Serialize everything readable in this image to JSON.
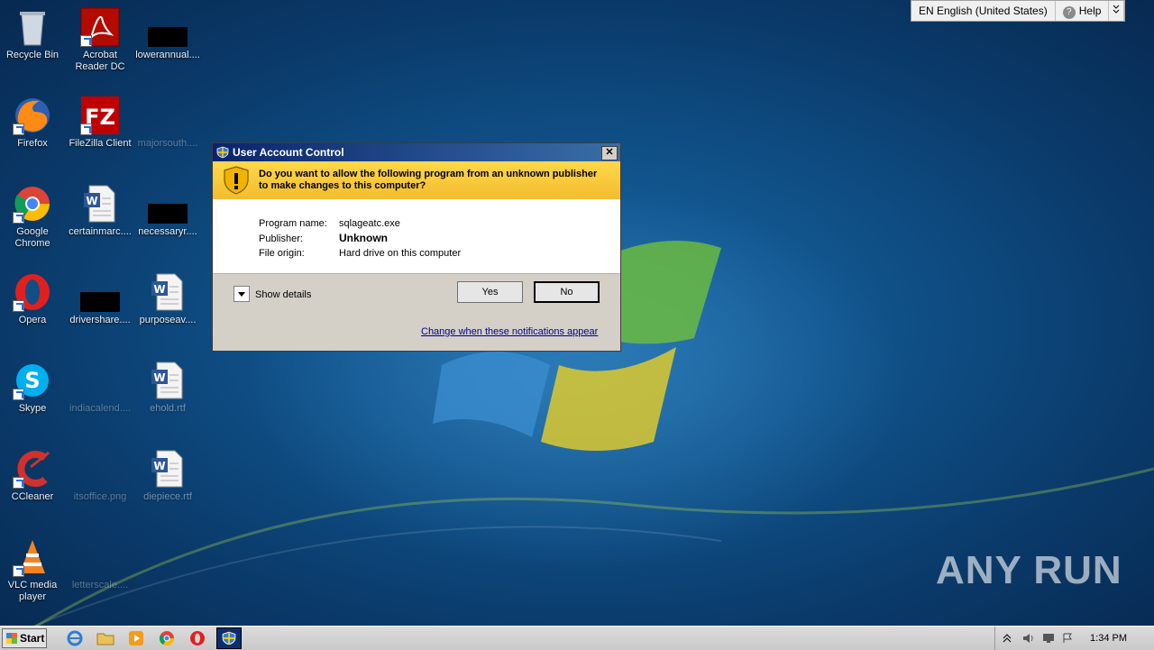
{
  "desktop": {
    "icons": [
      {
        "label": "Recycle Bin"
      },
      {
        "label": "Acrobat Reader DC"
      },
      {
        "label": "lowerannual...."
      },
      {
        "label": "Firefox"
      },
      {
        "label": "FileZilla Client"
      },
      {
        "label": "majorsouth...."
      },
      {
        "label": "Google Chrome"
      },
      {
        "label": "certainmarc...."
      },
      {
        "label": "necessaryr...."
      },
      {
        "label": "Opera"
      },
      {
        "label": "drivershare...."
      },
      {
        "label": "purposeav...."
      },
      {
        "label": "Skype"
      },
      {
        "label": "indiacalend...."
      },
      {
        "label": "ehold.rtf"
      },
      {
        "label": "CCleaner"
      },
      {
        "label": "itsoffice.png"
      },
      {
        "label": "diepiece.rtf"
      },
      {
        "label": "VLC media player"
      },
      {
        "label": "letterscale...."
      }
    ]
  },
  "langbar": {
    "language": "EN English (United States)",
    "help": "Help"
  },
  "uac": {
    "title": "User Account Control",
    "close_glyph": "✕",
    "question": "Do you want to allow the following program from an unknown publisher to make changes to this computer?",
    "program_label": "Program name:",
    "program_value": "sqlageatc.exe",
    "publisher_label": "Publisher:",
    "publisher_value": "Unknown",
    "origin_label": "File origin:",
    "origin_value": "Hard drive on this computer",
    "show_details": "Show details",
    "yes": "Yes",
    "no": "No",
    "change_link": "Change when these notifications appear"
  },
  "watermark": {
    "text": "ANY RUN"
  },
  "taskbar": {
    "start": "Start",
    "clock": "1:34 PM"
  }
}
